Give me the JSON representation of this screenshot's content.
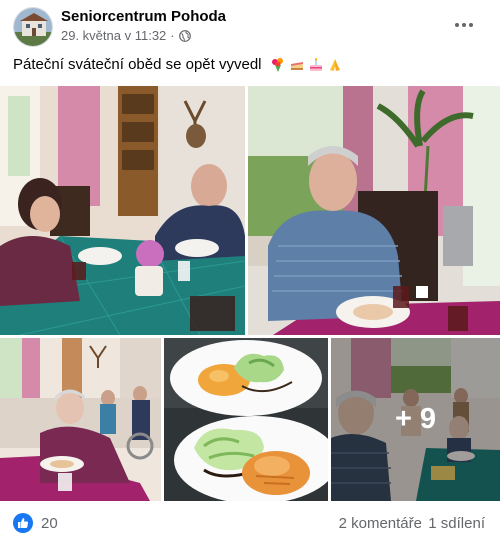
{
  "post": {
    "author": "Seniorcentrum Pohoda",
    "timestamp": "29. května v 11:32",
    "separator": "·",
    "audience_icon": "globe-icon",
    "more_icon": "ellipsis-icon",
    "text": "Páteční sváteční oběd se opět vyvedl",
    "emoji_icons": [
      "bouquet-emoji",
      "cake-slice-emoji",
      "birthday-cake-emoji",
      "folded-hands-emoji"
    ]
  },
  "gallery": {
    "more_overlay": "+ 9"
  },
  "footer": {
    "reaction_icon": "thumbs-up-icon",
    "like_count": "20",
    "comments": "2 komentáře",
    "shares": "1 sdílení"
  },
  "colors": {
    "accent": "#1877f2",
    "secondary_text": "#65676b",
    "tablecloth_teal": "#1f7f7a",
    "tablecloth_magenta": "#a2236b"
  }
}
